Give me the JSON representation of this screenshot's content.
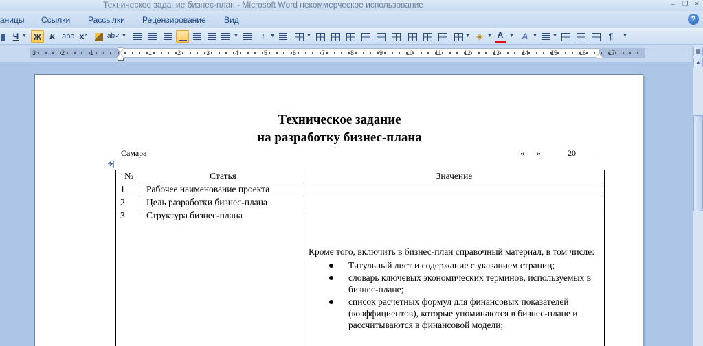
{
  "window": {
    "title": "Техническое задание бизнес-план - Microsoft Word некоммерческое использование"
  },
  "ribbon": {
    "tabs": [
      "аницы",
      "Ссылки",
      "Рассылки",
      "Рецензирование",
      "Вид"
    ],
    "help": "?"
  },
  "toolbar": {
    "underline": "Ч",
    "bold": "Ж",
    "italic": "К",
    "strike": "abc",
    "sub": "x²",
    "pilcrow": "¶",
    "font_color": "A"
  },
  "ruler": {
    "numbers": [
      "3",
      "2",
      "1",
      "1",
      "2",
      "3",
      "4",
      "5",
      "6",
      "7",
      "8",
      "9",
      "10",
      "11",
      "12",
      "13",
      "14",
      "15",
      "16",
      "17"
    ]
  },
  "document": {
    "title_line1": "Техническое задание",
    "title_line2": "на разработку бизнес-плана",
    "city": "Самара",
    "date_field": "«___» ______20____",
    "table": {
      "headers": [
        "№",
        "Статья",
        "Значение"
      ],
      "rows": [
        {
          "num": "1",
          "article": "Рабочее наименование проекта",
          "value": ""
        },
        {
          "num": "2",
          "article": "Цель разработки бизнес-плана",
          "value": ""
        },
        {
          "num": "3",
          "article": "Структура бизнес-плана",
          "value_intro": "Кроме того, включить в бизнес-план справочный материал, в том числе:",
          "bullets": [
            "Титульный лист и содержание с указанием страниц;",
            "словарь ключевых экономических терминов, используемых в бизнес-плане;",
            "список расчетных формул для финансовых показателей (коэффициентов), которые упоминаются в бизнес-плане и рассчитываются в финансовой модели;"
          ]
        }
      ]
    }
  }
}
